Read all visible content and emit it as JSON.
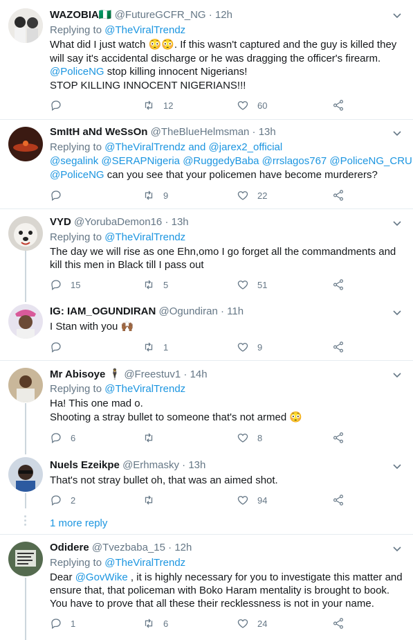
{
  "replying_label": "Replying to",
  "more_reply": "1 more reply",
  "tweets": [
    {
      "name": "WAZOBIA🇳🇬",
      "handle": "@FutureGCFR_NG",
      "time": "12h",
      "replying_to": [
        "@TheViralTrendz"
      ],
      "body": [
        "What did I just watch 😳😳. If this wasn't captured and the guy is killed they",
        "will say it's accidental discharge or he was dragging the officer's firearm.",
        "@PoliceNG stop killing innocent Nigerians!",
        "STOP KILLING INNOCENT NIGERIANS!!!"
      ],
      "replies": "",
      "retweets": "12",
      "likes": "60"
    },
    {
      "name": "SmItH aNd WeSsOn",
      "handle": "@TheBlueHelmsman",
      "time": "13h",
      "replying_to": [
        "@TheViralTrendz",
        "and",
        "@jarex2_official"
      ],
      "body": [
        "@segalink @SERAPNigeria @RuggedyBaba @rrslagos767 @PoliceNG_CRU",
        "@PoliceNG can you see that your policemen have become murderers?"
      ],
      "replies": "",
      "retweets": "9",
      "likes": "22"
    },
    {
      "name": "VYD",
      "handle": "@YorubaDemon16",
      "time": "13h",
      "replying_to": [
        "@TheViralTrendz"
      ],
      "body": [
        "The day we will rise as one Ehn,omo I go forget all the commandments and",
        "kill this men in Black till I pass out"
      ],
      "replies": "15",
      "retweets": "5",
      "likes": "51"
    },
    {
      "name": "IG: IAM_OGUNDIRAN",
      "handle": "@Ogundiran",
      "time": "11h",
      "replying_to": [],
      "body": [
        "I Stan with you 🙌🏾"
      ],
      "replies": "",
      "retweets": "1",
      "likes": "9"
    },
    {
      "name": "Mr Abisoye 🕴",
      "handle": "@Freestuv1",
      "time": "14h",
      "replying_to": [
        "@TheViralTrendz"
      ],
      "body": [
        "Ha! This one mad o.",
        "Shooting a stray bullet to someone that's not armed 😳"
      ],
      "replies": "6",
      "retweets": "",
      "likes": "8"
    },
    {
      "name": "Nuels Ezeikpe",
      "handle": "@Erhmasky",
      "time": "13h",
      "replying_to": [],
      "body": [
        "That's not stray bullet oh, that was an aimed shot."
      ],
      "replies": "2",
      "retweets": "",
      "likes": "94"
    },
    {
      "name": "Odidere",
      "handle": "@Tvezbaba_15",
      "time": "12h",
      "replying_to": [
        "@TheViralTrendz"
      ],
      "body": [
        "Dear @GovWike , it is highly necessary for you to investigate this matter and",
        "ensure that, that policeman with Boko Haram mentality is brought to book.",
        "You have to prove that all these their recklessness is not in your name."
      ],
      "replies": "1",
      "retweets": "6",
      "likes": "24"
    }
  ],
  "icons": {
    "reply": "reply-icon",
    "retweet": "retweet-icon",
    "like": "heart-icon",
    "share": "share-icon",
    "menu": "chevron-down-icon"
  },
  "colors": {
    "link": "#1b95e0",
    "muted": "#657786",
    "border": "#e6ecf0"
  }
}
